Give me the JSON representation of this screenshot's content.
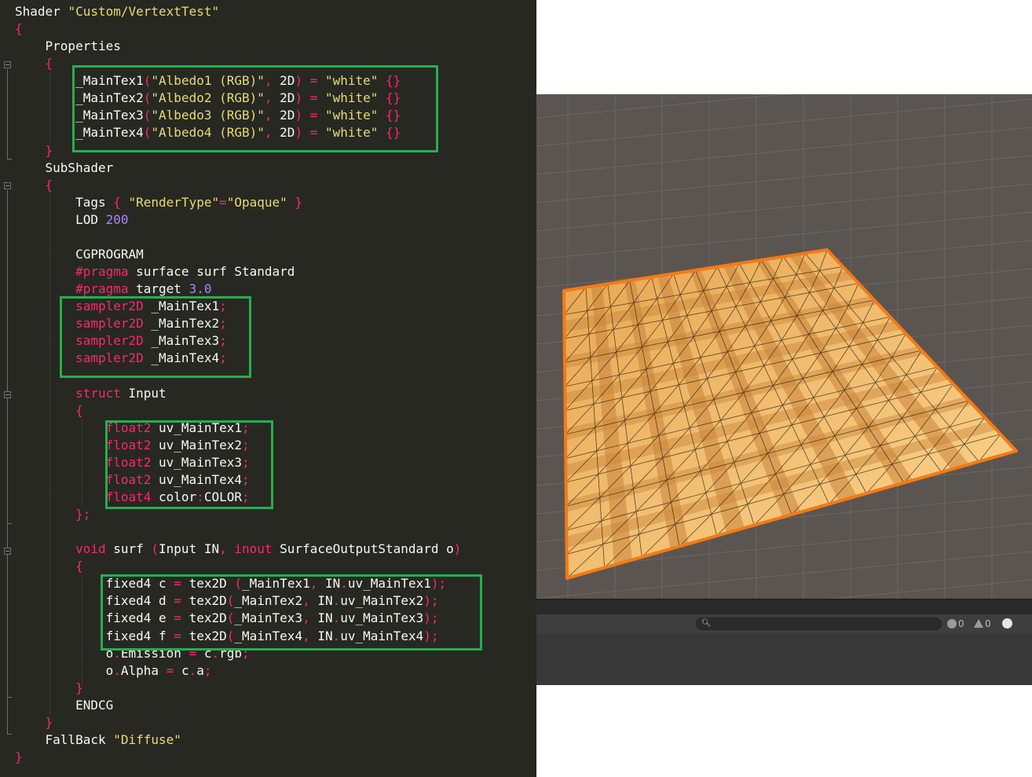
{
  "editor": {
    "lines": [
      [
        [
          "Shader ",
          "t"
        ],
        [
          "\"Custom/VertextTest\"",
          "s"
        ]
      ],
      [
        [
          "{",
          "k"
        ]
      ],
      [
        [
          "    Properties",
          "t"
        ]
      ],
      [
        [
          "    {",
          "k"
        ]
      ],
      [
        [
          "        _MainTex1",
          "t"
        ],
        [
          "(",
          "k"
        ],
        [
          "\"Albedo1 (RGB)\"",
          "s"
        ],
        [
          ", ",
          "k"
        ],
        [
          "2D",
          "t"
        ],
        [
          ") = ",
          "k"
        ],
        [
          "\"white\"",
          "s"
        ],
        [
          " {}",
          "k"
        ]
      ],
      [
        [
          "        _MainTex2",
          "t"
        ],
        [
          "(",
          "k"
        ],
        [
          "\"Albedo2 (RGB)\"",
          "s"
        ],
        [
          ", ",
          "k"
        ],
        [
          "2D",
          "t"
        ],
        [
          ") = ",
          "k"
        ],
        [
          "\"white\"",
          "s"
        ],
        [
          " {}",
          "k"
        ]
      ],
      [
        [
          "        _MainTex3",
          "t"
        ],
        [
          "(",
          "k"
        ],
        [
          "\"Albedo3 (RGB)\"",
          "s"
        ],
        [
          ", ",
          "k"
        ],
        [
          "2D",
          "t"
        ],
        [
          ") = ",
          "k"
        ],
        [
          "\"white\"",
          "s"
        ],
        [
          " {}",
          "k"
        ]
      ],
      [
        [
          "        _MainTex4",
          "t"
        ],
        [
          "(",
          "k"
        ],
        [
          "\"Albedo4 (RGB)\"",
          "s"
        ],
        [
          ", ",
          "k"
        ],
        [
          "2D",
          "t"
        ],
        [
          ") = ",
          "k"
        ],
        [
          "\"white\"",
          "s"
        ],
        [
          " {}",
          "k"
        ]
      ],
      [
        [
          "    }",
          "k"
        ]
      ],
      [
        [
          "    SubShader",
          "t"
        ]
      ],
      [
        [
          "    {",
          "k"
        ]
      ],
      [
        [
          "        Tags ",
          "t"
        ],
        [
          "{ ",
          "k"
        ],
        [
          "\"RenderType\"",
          "s"
        ],
        [
          "=",
          "k"
        ],
        [
          "\"Opaque\"",
          "s"
        ],
        [
          " }",
          "k"
        ]
      ],
      [
        [
          "        LOD ",
          "t"
        ],
        [
          "200",
          "n"
        ]
      ],
      [
        [
          "",
          "t"
        ]
      ],
      [
        [
          "        CGPROGRAM",
          "t"
        ]
      ],
      [
        [
          "        ",
          "t"
        ],
        [
          "#pragma",
          "k"
        ],
        [
          " surface surf Standard",
          "t"
        ]
      ],
      [
        [
          "        ",
          "t"
        ],
        [
          "#pragma",
          "k"
        ],
        [
          " target ",
          "t"
        ],
        [
          "3.0",
          "n"
        ]
      ],
      [
        [
          "        ",
          "t"
        ],
        [
          "sampler2D",
          "k"
        ],
        [
          " _MainTex1",
          "t"
        ],
        [
          ";",
          "k"
        ]
      ],
      [
        [
          "        ",
          "t"
        ],
        [
          "sampler2D",
          "k"
        ],
        [
          " _MainTex2",
          "t"
        ],
        [
          ";",
          "k"
        ]
      ],
      [
        [
          "        ",
          "t"
        ],
        [
          "sampler2D",
          "k"
        ],
        [
          " _MainTex3",
          "t"
        ],
        [
          ";",
          "k"
        ]
      ],
      [
        [
          "        ",
          "t"
        ],
        [
          "sampler2D",
          "k"
        ],
        [
          " _MainTex4",
          "t"
        ],
        [
          ";",
          "k"
        ]
      ],
      [
        [
          "",
          "t"
        ]
      ],
      [
        [
          "        ",
          "t"
        ],
        [
          "struct",
          "k"
        ],
        [
          " Input",
          "t"
        ]
      ],
      [
        [
          "        {",
          "k"
        ]
      ],
      [
        [
          "            ",
          "t"
        ],
        [
          "float2",
          "k"
        ],
        [
          " uv_MainTex1",
          "t"
        ],
        [
          ";",
          "k"
        ]
      ],
      [
        [
          "            ",
          "t"
        ],
        [
          "float2",
          "k"
        ],
        [
          " uv_MainTex2",
          "t"
        ],
        [
          ";",
          "k"
        ]
      ],
      [
        [
          "            ",
          "t"
        ],
        [
          "float2",
          "k"
        ],
        [
          " uv_MainTex3",
          "t"
        ],
        [
          ";",
          "k"
        ]
      ],
      [
        [
          "            ",
          "t"
        ],
        [
          "float2",
          "k"
        ],
        [
          " uv_MainTex4",
          "t"
        ],
        [
          ";",
          "k"
        ]
      ],
      [
        [
          "            ",
          "t"
        ],
        [
          "float4",
          "k"
        ],
        [
          " color",
          "t"
        ],
        [
          ":",
          "k"
        ],
        [
          "COLOR",
          "t"
        ],
        [
          ";",
          "k"
        ]
      ],
      [
        [
          "        };",
          "k"
        ]
      ],
      [
        [
          "",
          "t"
        ]
      ],
      [
        [
          "        ",
          "t"
        ],
        [
          "void",
          "k"
        ],
        [
          " surf ",
          "t"
        ],
        [
          "(",
          "k"
        ],
        [
          "Input IN",
          "t"
        ],
        [
          ", ",
          "k"
        ],
        [
          "inout",
          "k"
        ],
        [
          " SurfaceOutputStandard o",
          "t"
        ],
        [
          ")",
          "k"
        ]
      ],
      [
        [
          "        {",
          "k"
        ]
      ],
      [
        [
          "            fixed4 c ",
          "t"
        ],
        [
          "=",
          "k"
        ],
        [
          " tex2D ",
          "t"
        ],
        [
          "(",
          "k"
        ],
        [
          "_MainTex1",
          "t"
        ],
        [
          ", ",
          "k"
        ],
        [
          "IN",
          "t"
        ],
        [
          ".",
          "k"
        ],
        [
          "uv_MainTex1",
          "t"
        ],
        [
          ");",
          "k"
        ]
      ],
      [
        [
          "            fixed4 d ",
          "t"
        ],
        [
          "=",
          "k"
        ],
        [
          " tex2D",
          "t"
        ],
        [
          "(",
          "k"
        ],
        [
          "_MainTex2",
          "t"
        ],
        [
          ", ",
          "k"
        ],
        [
          "IN",
          "t"
        ],
        [
          ".",
          "k"
        ],
        [
          "uv_MainTex2",
          "t"
        ],
        [
          ");",
          "k"
        ]
      ],
      [
        [
          "            fixed4 e ",
          "t"
        ],
        [
          "=",
          "k"
        ],
        [
          " tex2D",
          "t"
        ],
        [
          "(",
          "k"
        ],
        [
          "_MainTex3",
          "t"
        ],
        [
          ", ",
          "k"
        ],
        [
          "IN",
          "t"
        ],
        [
          ".",
          "k"
        ],
        [
          "uv_MainTex3",
          "t"
        ],
        [
          ");",
          "k"
        ]
      ],
      [
        [
          "            fixed4 f ",
          "t"
        ],
        [
          "=",
          "k"
        ],
        [
          " tex2D",
          "t"
        ],
        [
          "(",
          "k"
        ],
        [
          "_MainTex4",
          "t"
        ],
        [
          ", ",
          "k"
        ],
        [
          "IN",
          "t"
        ],
        [
          ".",
          "k"
        ],
        [
          "uv_MainTex4",
          "t"
        ],
        [
          ");",
          "k"
        ]
      ],
      [
        [
          "            o",
          "t"
        ],
        [
          ".",
          "k"
        ],
        [
          "Emission ",
          "t"
        ],
        [
          "=",
          "k"
        ],
        [
          " c",
          "t"
        ],
        [
          ".",
          "k"
        ],
        [
          "rgb",
          "t"
        ],
        [
          ";",
          "k"
        ]
      ],
      [
        [
          "            o",
          "t"
        ],
        [
          ".",
          "k"
        ],
        [
          "Alpha ",
          "t"
        ],
        [
          "=",
          "k"
        ],
        [
          " c",
          "t"
        ],
        [
          ".",
          "k"
        ],
        [
          "a",
          "t"
        ],
        [
          ";",
          "k"
        ]
      ],
      [
        [
          "        }",
          "k"
        ]
      ],
      [
        [
          "        ENDCG",
          "t"
        ]
      ],
      [
        [
          "    }",
          "k"
        ]
      ],
      [
        [
          "    FallBack ",
          "t"
        ],
        [
          "\"Diffuse\"",
          "s"
        ]
      ],
      [
        [
          "}",
          "k"
        ]
      ]
    ]
  },
  "console": {
    "search_placeholder": "",
    "info_count": "0",
    "warning_count": "0"
  },
  "colors": {
    "editor_bg": "#272822",
    "highlight": "#27ae4e",
    "selection_outline": "#f47a14",
    "scene_bg": "#5b5551"
  }
}
